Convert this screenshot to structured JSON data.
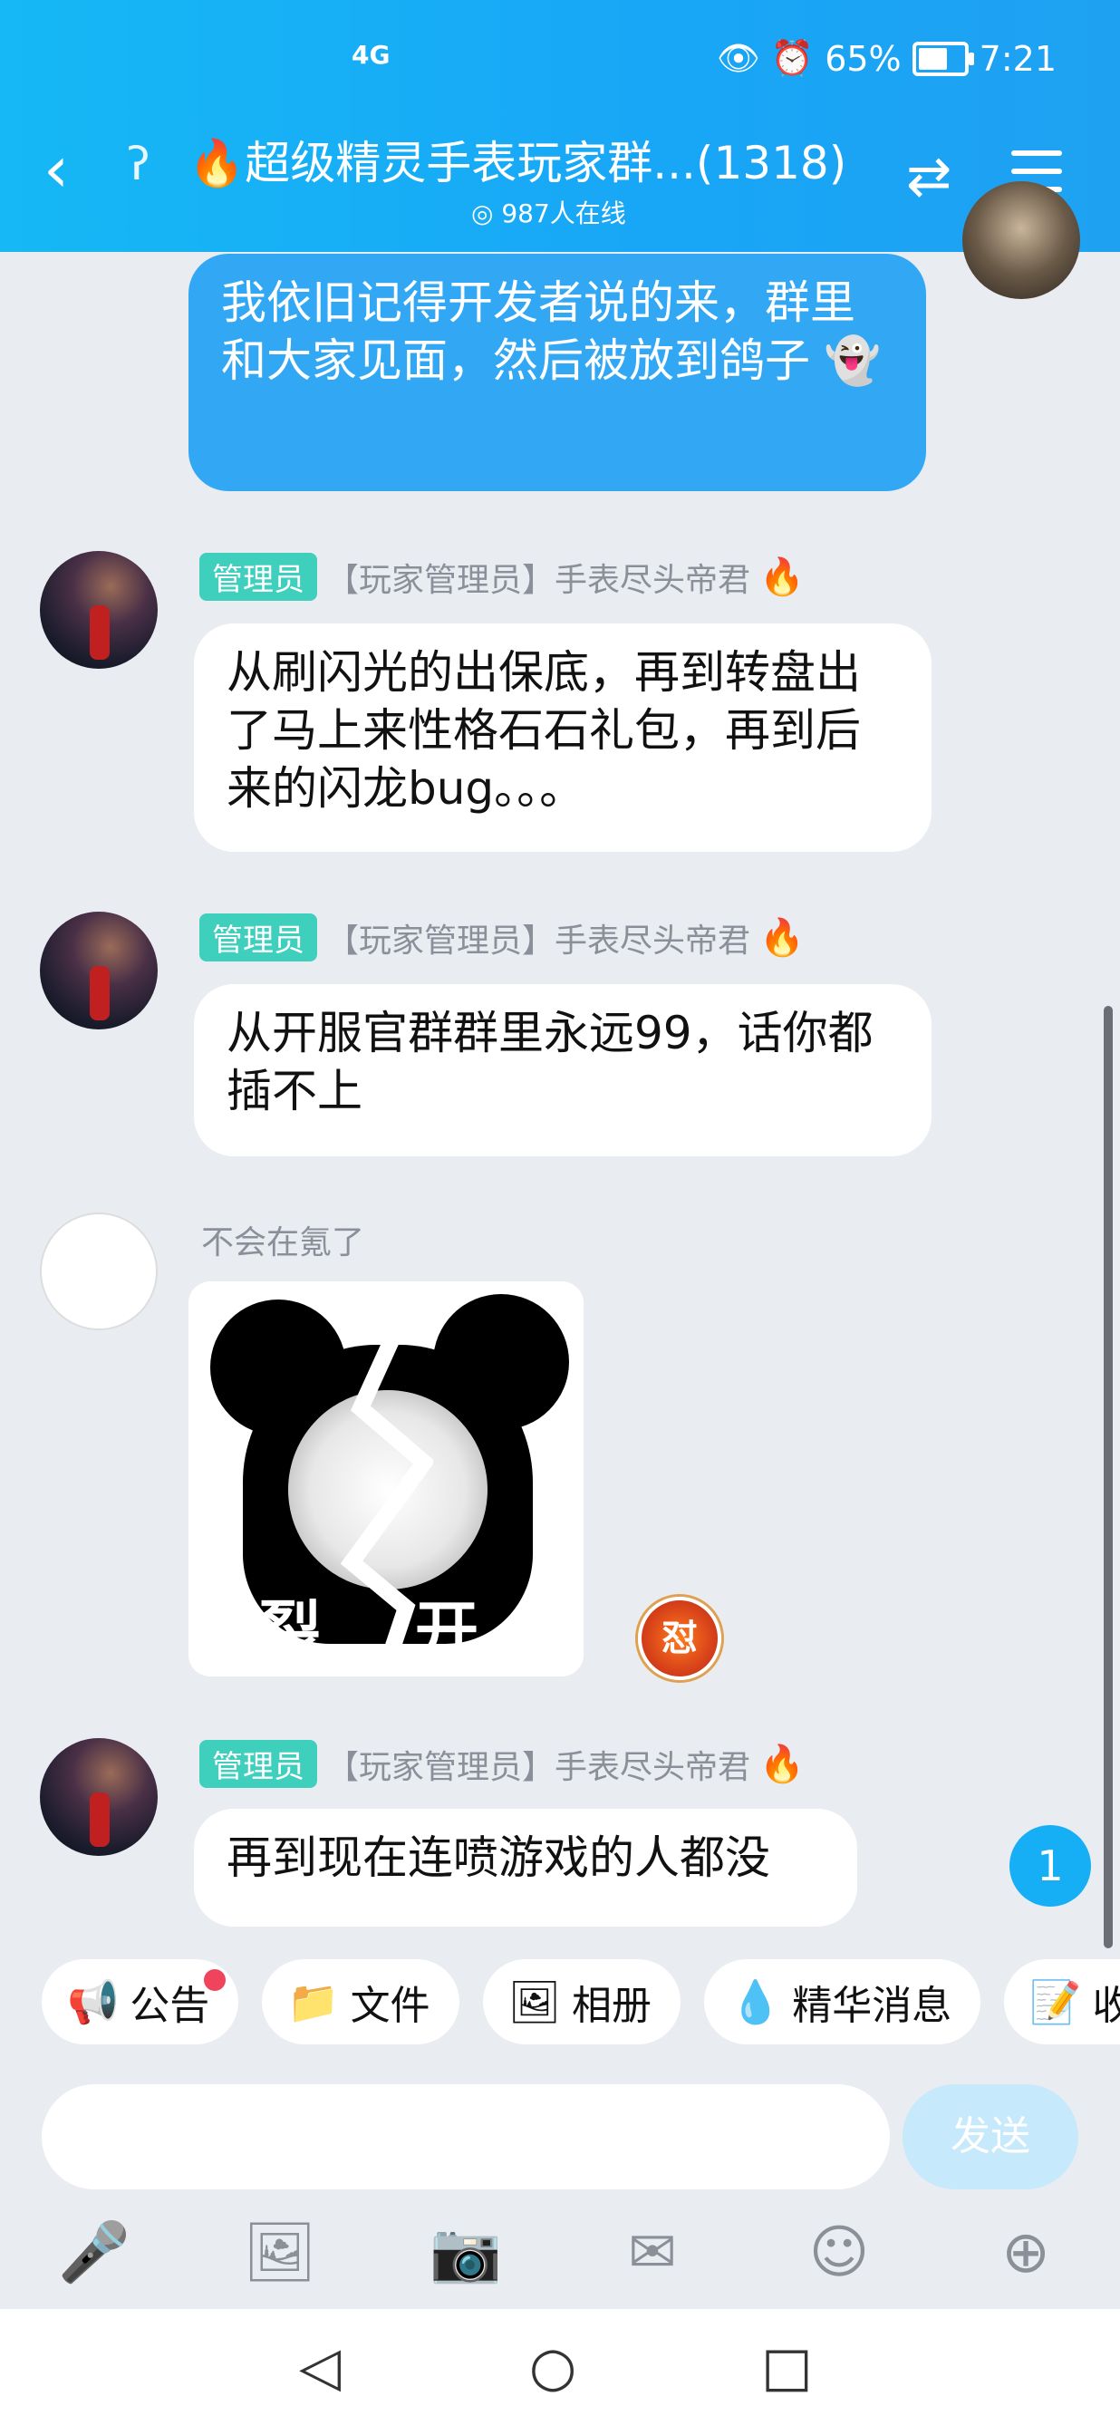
{
  "status_bar": {
    "signal": "4G",
    "battery": "65%",
    "battery_fraction": 0.65,
    "time": "7:21"
  },
  "header": {
    "title": "🔥超级精灵手表玩家群...(1318)",
    "online": "987人在线"
  },
  "messages": [
    {
      "from": "me",
      "text": "我依旧记得开发者说的来，群里和大家见面，然后被放到鸽子"
    },
    {
      "from": "other",
      "badge": "管理员",
      "sender": "【玩家管理员】手表尽头帝君",
      "text": "从刷闪光的出保底，再到转盘出了马上来性格石石礼包，再到后来的闪龙bug。。。"
    },
    {
      "from": "other",
      "badge": "管理员",
      "sender": "【玩家管理员】手表尽头帝君",
      "text": "从开服官群群里永远99，话你都插不上"
    },
    {
      "from": "other",
      "sender": "不会在氪了",
      "sticker_text_left": "裂",
      "sticker_text_right": "开",
      "reaction_badge": "怼"
    },
    {
      "from": "other",
      "badge": "管理员",
      "sender": "【玩家管理员】手表尽头帝君",
      "text": "再到现在连喷游戏的人都没"
    }
  ],
  "unread_count": "1",
  "quick_actions": [
    "公告",
    "文件",
    "相册",
    "精华消息",
    "收"
  ],
  "input": {
    "placeholder": "",
    "send_label": "发送"
  },
  "icons": {
    "toolbar": [
      "microphone-icon",
      "image-icon",
      "camera-icon",
      "red-packet-icon",
      "emoji-icon",
      "plus-icon"
    ]
  },
  "colors": {
    "header": "#18a6f6",
    "my_bubble": "#32a7f4",
    "admin_badge": "#3fcfbd"
  }
}
